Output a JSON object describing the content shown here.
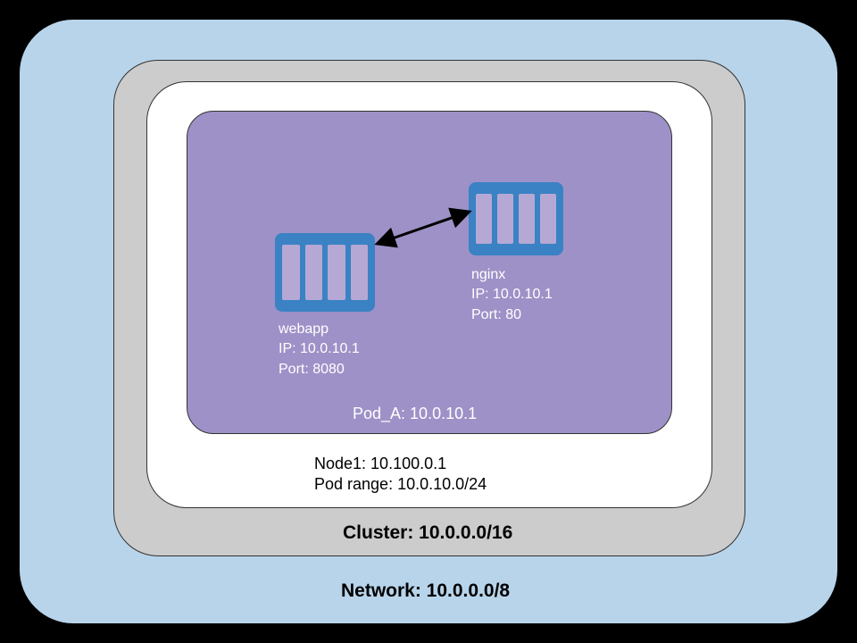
{
  "network": {
    "label": "Network: 10.0.0.0/8"
  },
  "cluster": {
    "label": "Cluster: 10.0.0.0/16"
  },
  "node": {
    "line1": "Node1: 10.100.0.1",
    "line2": "Pod range: 10.0.10.0/24"
  },
  "pod": {
    "label": "Pod_A: 10.0.10.1"
  },
  "containers": {
    "webapp": {
      "name": "webapp",
      "ip": "IP: 10.0.10.1",
      "port": "Port: 8080"
    },
    "nginx": {
      "name": "nginx",
      "ip": "IP: 10.0.10.1",
      "port": "Port: 80"
    }
  }
}
